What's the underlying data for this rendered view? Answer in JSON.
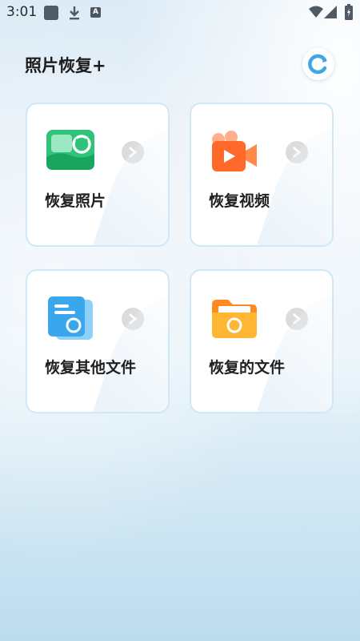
{
  "status_bar": {
    "time": "3:01",
    "notification_letter": "A"
  },
  "header": {
    "title": "照片恢复+"
  },
  "cards": [
    {
      "label": "恢复照片",
      "icon": "photo-restore-icon",
      "color": "#2fc27a"
    },
    {
      "label": "恢复视频",
      "icon": "video-camera-icon",
      "color": "#ff6a2b"
    },
    {
      "label": "恢复其他文件",
      "icon": "document-restore-icon",
      "color": "#3aa6ec"
    },
    {
      "label": "恢复的文件",
      "icon": "folder-restore-icon",
      "color": "#ffa41f"
    }
  ],
  "colors": {
    "card_border": "#cfe8f7",
    "arrow_bg": "#dcdcdc",
    "text": "#202020"
  }
}
